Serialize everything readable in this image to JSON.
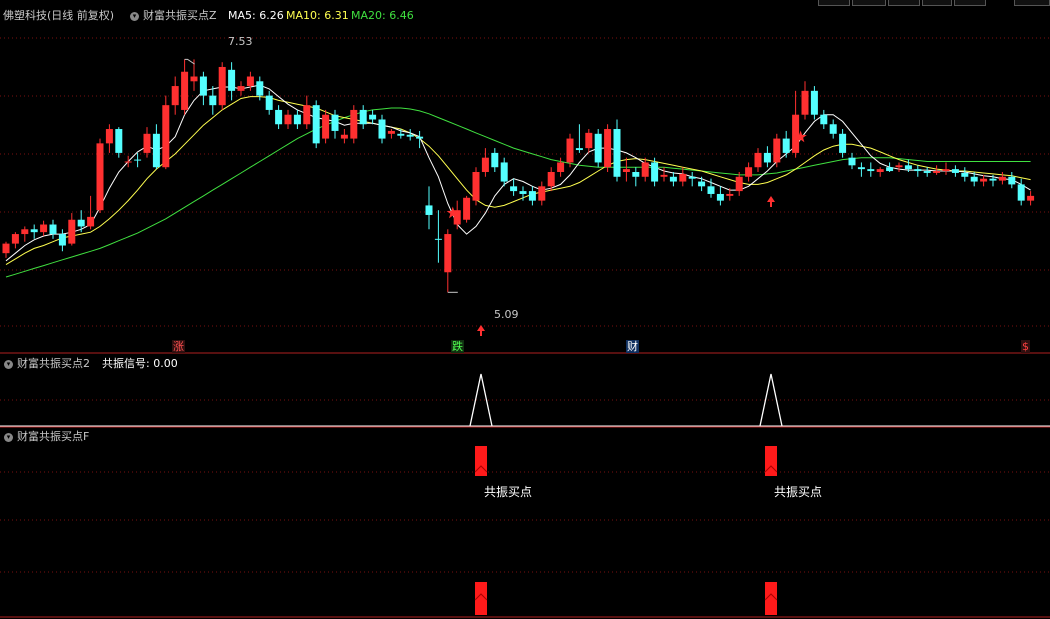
{
  "colors": {
    "bg": "#000000",
    "grid": "#7a1010",
    "up": "#ff3030",
    "down": "#54ffff",
    "ma5": "#ffffff",
    "ma10": "#ffff50",
    "ma20": "#40e040",
    "text": "#c8c8c8",
    "signal": "#ffffff"
  },
  "header": {
    "stock": "佛塑科技(日线 前复权)",
    "indicator": "财富共振买点Z",
    "ma5": "MA5: 6.26",
    "ma10": "MA10: 6.31",
    "ma20": "MA20: 6.46"
  },
  "annotations": {
    "high": "7.53",
    "low": "5.09"
  },
  "markers": {
    "zhang": "涨",
    "die": "跌",
    "cai": "财",
    "dollar": "$"
  },
  "panel2": {
    "title": "财富共振买点2",
    "value": "共振信号: 0.00"
  },
  "panel3": {
    "title": "财富共振买点F",
    "signal_label_1": "共振买点",
    "signal_label_2": "共振买点"
  },
  "icons": {
    "collapse": "chevron-down-icon",
    "star": "star-icon",
    "arrow": "arrow-up-icon"
  },
  "chart_data": {
    "type": "candlestick",
    "ylim": [
      4.8,
      7.9
    ],
    "candles": [
      [
        5.5,
        5.6,
        5.45,
        5.62
      ],
      [
        5.6,
        5.7,
        5.55,
        5.72
      ],
      [
        5.7,
        5.75,
        5.62,
        5.78
      ],
      [
        5.75,
        5.72,
        5.65,
        5.8
      ],
      [
        5.72,
        5.8,
        5.68,
        5.84
      ],
      [
        5.8,
        5.7,
        5.65,
        5.85
      ],
      [
        5.7,
        5.58,
        5.52,
        5.75
      ],
      [
        5.6,
        5.85,
        5.58,
        5.92
      ],
      [
        5.85,
        5.78,
        5.72,
        5.95
      ],
      [
        5.78,
        5.88,
        5.75,
        6.1
      ],
      [
        5.95,
        6.65,
        5.92,
        6.7
      ],
      [
        6.65,
        6.8,
        6.55,
        6.85
      ],
      [
        6.8,
        6.55,
        6.5,
        6.82
      ],
      [
        6.45,
        6.46,
        6.4,
        6.52
      ],
      [
        6.48,
        6.47,
        6.4,
        6.55
      ],
      [
        6.55,
        6.75,
        6.5,
        6.82
      ],
      [
        6.75,
        6.4,
        6.38,
        6.85
      ],
      [
        6.4,
        7.05,
        6.38,
        7.15
      ],
      [
        7.05,
        7.25,
        6.95,
        7.35
      ],
      [
        7.0,
        7.4,
        6.95,
        7.53
      ],
      [
        7.3,
        7.35,
        7.2,
        7.53
      ],
      [
        7.35,
        7.15,
        7.05,
        7.4
      ],
      [
        7.15,
        7.05,
        6.95,
        7.25
      ],
      [
        7.05,
        7.45,
        7.0,
        7.5
      ],
      [
        7.42,
        7.2,
        7.1,
        7.5
      ],
      [
        7.2,
        7.25,
        7.15,
        7.3
      ],
      [
        7.25,
        7.35,
        7.2,
        7.4
      ],
      [
        7.3,
        7.15,
        7.1,
        7.35
      ],
      [
        7.15,
        7.0,
        6.95,
        7.2
      ],
      [
        7.0,
        6.85,
        6.8,
        7.05
      ],
      [
        6.85,
        6.95,
        6.8,
        7.0
      ],
      [
        6.95,
        6.85,
        6.8,
        7.0
      ],
      [
        6.85,
        7.05,
        6.8,
        7.15
      ],
      [
        7.05,
        6.65,
        6.6,
        7.1
      ],
      [
        6.7,
        6.95,
        6.65,
        7.0
      ],
      [
        6.95,
        6.78,
        6.7,
        7.0
      ],
      [
        6.7,
        6.74,
        6.65,
        6.8
      ],
      [
        6.7,
        7.0,
        6.65,
        7.05
      ],
      [
        7.0,
        6.85,
        6.8,
        7.05
      ],
      [
        6.95,
        6.9,
        6.85,
        7.0
      ],
      [
        6.9,
        6.7,
        6.65,
        6.95
      ],
      [
        6.75,
        6.78,
        6.7,
        6.8
      ],
      [
        6.75,
        6.73,
        6.7,
        6.8
      ],
      [
        6.74,
        6.72,
        6.68,
        6.8
      ],
      [
        6.72,
        6.7,
        6.6,
        6.78
      ],
      [
        6.0,
        5.9,
        5.75,
        6.2
      ],
      [
        5.65,
        5.64,
        5.4,
        5.95
      ],
      [
        5.3,
        5.7,
        5.09,
        5.75
      ],
      [
        5.8,
        5.95,
        5.75,
        6.05
      ],
      [
        5.85,
        6.08,
        5.82,
        6.1
      ],
      [
        6.05,
        6.35,
        6.0,
        6.4
      ],
      [
        6.35,
        6.5,
        6.3,
        6.6
      ],
      [
        6.55,
        6.4,
        6.35,
        6.6
      ],
      [
        6.45,
        6.25,
        6.2,
        6.5
      ],
      [
        6.2,
        6.15,
        6.1,
        6.28
      ],
      [
        6.15,
        6.12,
        6.05,
        6.2
      ],
      [
        6.15,
        6.05,
        6.0,
        6.2
      ],
      [
        6.05,
        6.2,
        6.0,
        6.25
      ],
      [
        6.2,
        6.35,
        6.15,
        6.4
      ],
      [
        6.35,
        6.45,
        6.3,
        6.5
      ],
      [
        6.45,
        6.7,
        6.4,
        6.75
      ],
      [
        6.6,
        6.58,
        6.55,
        6.85
      ],
      [
        6.6,
        6.76,
        6.55,
        6.8
      ],
      [
        6.75,
        6.45,
        6.4,
        6.8
      ],
      [
        6.4,
        6.8,
        6.35,
        6.85
      ],
      [
        6.8,
        6.3,
        6.25,
        6.9
      ],
      [
        6.35,
        6.38,
        6.25,
        6.5
      ],
      [
        6.35,
        6.3,
        6.2,
        6.4
      ],
      [
        6.3,
        6.45,
        6.25,
        6.5
      ],
      [
        6.45,
        6.25,
        6.2,
        6.5
      ],
      [
        6.3,
        6.32,
        6.25,
        6.4
      ],
      [
        6.3,
        6.25,
        6.2,
        6.35
      ],
      [
        6.25,
        6.33,
        6.2,
        6.4
      ],
      [
        6.3,
        6.28,
        6.2,
        6.35
      ],
      [
        6.25,
        6.2,
        6.15,
        6.3
      ],
      [
        6.2,
        6.12,
        6.08,
        6.28
      ],
      [
        6.12,
        6.05,
        6.0,
        6.2
      ],
      [
        6.1,
        6.12,
        6.05,
        6.18
      ],
      [
        6.15,
        6.3,
        6.1,
        6.35
      ],
      [
        6.3,
        6.4,
        6.25,
        6.45
      ],
      [
        6.4,
        6.55,
        6.35,
        6.6
      ],
      [
        6.55,
        6.45,
        6.4,
        6.62
      ],
      [
        6.45,
        6.7,
        6.4,
        6.75
      ],
      [
        6.7,
        6.55,
        6.5,
        6.78
      ],
      [
        6.55,
        6.95,
        6.5,
        7.2
      ],
      [
        6.95,
        7.2,
        6.9,
        7.3
      ],
      [
        7.2,
        6.95,
        6.9,
        7.25
      ],
      [
        6.95,
        6.85,
        6.8,
        7.0
      ],
      [
        6.85,
        6.75,
        6.7,
        6.9
      ],
      [
        6.75,
        6.55,
        6.5,
        6.8
      ],
      [
        6.5,
        6.42,
        6.38,
        6.55
      ],
      [
        6.4,
        6.38,
        6.3,
        6.45
      ],
      [
        6.38,
        6.36,
        6.3,
        6.45
      ],
      [
        6.35,
        6.38,
        6.3,
        6.4
      ],
      [
        6.4,
        6.36,
        6.35,
        6.45
      ],
      [
        6.4,
        6.42,
        6.35,
        6.45
      ],
      [
        6.42,
        6.38,
        6.35,
        6.48
      ],
      [
        6.38,
        6.36,
        6.3,
        6.42
      ],
      [
        6.36,
        6.34,
        6.3,
        6.4
      ],
      [
        6.34,
        6.36,
        6.32,
        6.42
      ],
      [
        6.36,
        6.38,
        6.32,
        6.45
      ],
      [
        6.38,
        6.34,
        6.3,
        6.42
      ],
      [
        6.34,
        6.3,
        6.25,
        6.4
      ],
      [
        6.3,
        6.25,
        6.2,
        6.35
      ],
      [
        6.25,
        6.28,
        6.2,
        6.32
      ],
      [
        6.28,
        6.26,
        6.2,
        6.32
      ],
      [
        6.26,
        6.3,
        6.22,
        6.35
      ],
      [
        6.3,
        6.22,
        6.18,
        6.35
      ],
      [
        6.22,
        6.05,
        6.0,
        6.28
      ],
      [
        6.05,
        6.1,
        6.0,
        6.15
      ]
    ],
    "ma5": [
      5.42,
      5.5,
      5.58,
      5.64,
      5.68,
      5.7,
      5.7,
      5.72,
      5.75,
      5.8,
      5.98,
      6.18,
      6.35,
      6.46,
      6.56,
      6.62,
      6.58,
      6.62,
      6.72,
      6.95,
      7.1,
      7.2,
      7.22,
      7.24,
      7.24,
      7.22,
      7.24,
      7.26,
      7.22,
      7.14,
      7.06,
      7.0,
      6.96,
      6.92,
      6.9,
      6.88,
      6.84,
      6.86,
      6.86,
      6.86,
      6.84,
      6.82,
      6.78,
      6.76,
      6.72,
      6.5,
      6.3,
      6.02,
      5.8,
      5.7,
      5.78,
      5.92,
      6.1,
      6.22,
      6.28,
      6.25,
      6.2,
      6.16,
      6.18,
      6.22,
      6.32,
      6.45,
      6.56,
      6.6,
      6.6,
      6.58,
      6.55,
      6.5,
      6.44,
      6.4,
      6.36,
      6.34,
      6.33,
      6.3,
      6.28,
      6.24,
      6.2,
      6.16,
      6.16,
      6.2,
      6.28,
      6.36,
      6.46,
      6.54,
      6.62,
      6.76,
      6.88,
      6.95,
      6.95,
      6.88,
      6.76,
      6.64,
      6.52,
      6.44,
      6.4,
      6.38,
      6.37,
      6.37,
      6.37,
      6.36,
      6.36,
      6.36,
      6.35,
      6.33,
      6.31,
      6.3,
      6.28,
      6.27,
      6.22,
      6.16
    ],
    "ma10": [
      5.38,
      5.44,
      5.5,
      5.55,
      5.58,
      5.62,
      5.66,
      5.68,
      5.7,
      5.72,
      5.78,
      5.86,
      5.95,
      6.05,
      6.16,
      6.28,
      6.38,
      6.46,
      6.54,
      6.64,
      6.74,
      6.84,
      6.92,
      7.0,
      7.06,
      7.12,
      7.14,
      7.14,
      7.13,
      7.1,
      7.08,
      7.06,
      7.04,
      7.02,
      6.98,
      6.94,
      6.92,
      6.9,
      6.88,
      6.86,
      6.84,
      6.82,
      6.8,
      6.76,
      6.7,
      6.62,
      6.52,
      6.4,
      6.28,
      6.16,
      6.06,
      6.0,
      5.98,
      6.0,
      6.04,
      6.08,
      6.12,
      6.14,
      6.16,
      6.18,
      6.2,
      6.24,
      6.3,
      6.36,
      6.42,
      6.46,
      6.48,
      6.49,
      6.48,
      6.46,
      6.44,
      6.42,
      6.4,
      6.38,
      6.36,
      6.33,
      6.3,
      6.27,
      6.24,
      6.22,
      6.22,
      6.24,
      6.28,
      6.32,
      6.38,
      6.45,
      6.52,
      6.58,
      6.62,
      6.64,
      6.64,
      6.62,
      6.6,
      6.56,
      6.52,
      6.48,
      6.45,
      6.42,
      6.4,
      6.38,
      6.37,
      6.36,
      6.36,
      6.35,
      6.34,
      6.33,
      6.32,
      6.31,
      6.29,
      6.27
    ],
    "ma20": [
      5.25,
      5.28,
      5.31,
      5.34,
      5.37,
      5.4,
      5.43,
      5.46,
      5.49,
      5.52,
      5.55,
      5.59,
      5.63,
      5.67,
      5.71,
      5.76,
      5.81,
      5.86,
      5.92,
      5.98,
      6.04,
      6.1,
      6.16,
      6.22,
      6.28,
      6.34,
      6.4,
      6.46,
      6.52,
      6.58,
      6.64,
      6.7,
      6.75,
      6.8,
      6.84,
      6.88,
      6.92,
      6.95,
      6.98,
      7.0,
      7.01,
      7.02,
      7.02,
      7.01,
      6.99,
      6.96,
      6.92,
      6.88,
      6.84,
      6.8,
      6.76,
      6.72,
      6.68,
      6.64,
      6.6,
      6.57,
      6.54,
      6.51,
      6.48,
      6.46,
      6.44,
      6.42,
      6.41,
      6.4,
      6.4,
      6.4,
      6.4,
      6.4,
      6.4,
      6.4,
      6.4,
      6.39,
      6.38,
      6.37,
      6.36,
      6.35,
      6.34,
      6.33,
      6.32,
      6.32,
      6.32,
      6.33,
      6.34,
      6.36,
      6.38,
      6.4,
      6.42,
      6.44,
      6.46,
      6.48,
      6.49,
      6.5,
      6.5,
      6.5,
      6.5,
      6.49,
      6.48,
      6.47,
      6.46,
      6.46,
      6.46,
      6.46,
      6.46,
      6.46,
      6.46,
      6.46,
      6.46,
      6.46,
      6.46,
      6.46
    ],
    "signal_bars": [
      47,
      84
    ],
    "signal_value": 0.0
  }
}
